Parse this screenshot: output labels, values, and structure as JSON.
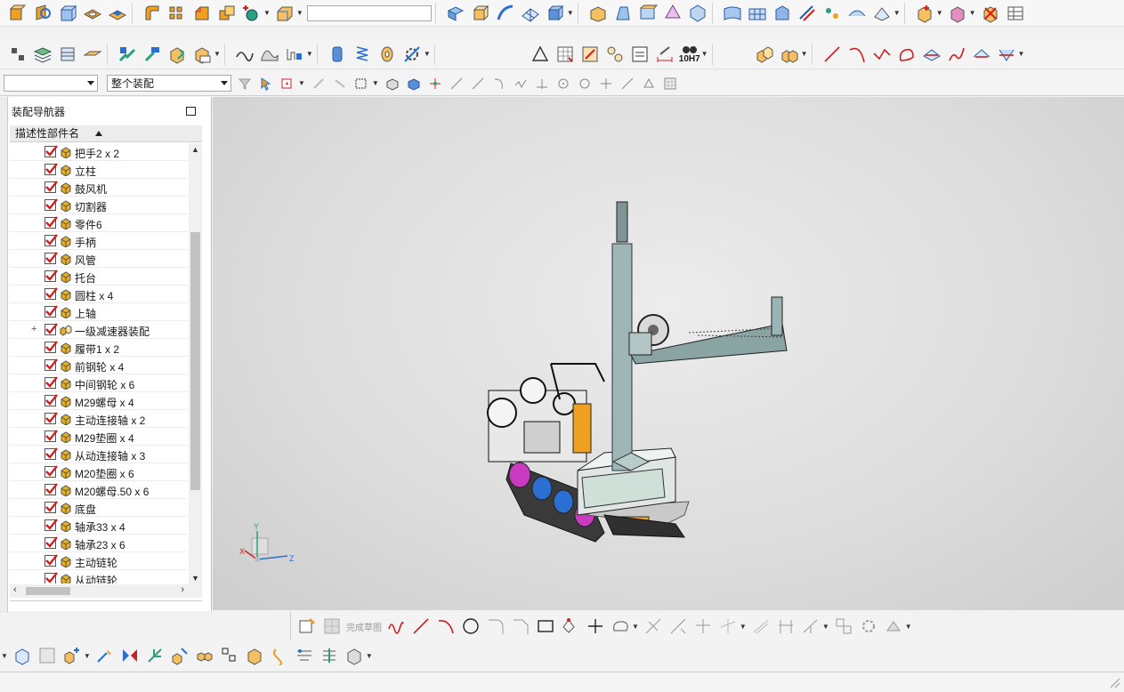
{
  "assembly_scope": {
    "filter_value": "",
    "scope_value": "整个装配"
  },
  "navigator": {
    "title": "装配导航器",
    "column_header": "描述性部件名",
    "items": [
      {
        "label": "把手2 x 2",
        "expandable": false
      },
      {
        "label": "立柱",
        "expandable": false
      },
      {
        "label": "鼓风机",
        "expandable": false
      },
      {
        "label": "切割器",
        "expandable": false
      },
      {
        "label": "零件6",
        "expandable": false
      },
      {
        "label": "手柄",
        "expandable": false
      },
      {
        "label": "风管",
        "expandable": false
      },
      {
        "label": "托台",
        "expandable": false
      },
      {
        "label": "圆柱 x 4",
        "expandable": false
      },
      {
        "label": "上轴",
        "expandable": false
      },
      {
        "label": "一级减速器装配",
        "expandable": true
      },
      {
        "label": "履带1 x 2",
        "expandable": false
      },
      {
        "label": "前钢轮 x 4",
        "expandable": false
      },
      {
        "label": "中间钢轮 x 6",
        "expandable": false
      },
      {
        "label": "M29螺母 x 4",
        "expandable": false
      },
      {
        "label": "主动连接轴 x 2",
        "expandable": false
      },
      {
        "label": "M29垫圈 x 4",
        "expandable": false
      },
      {
        "label": "从动连接轴 x 3",
        "expandable": false
      },
      {
        "label": "M20垫圈 x 6",
        "expandable": false
      },
      {
        "label": "M20螺母.50 x 6",
        "expandable": false
      },
      {
        "label": "底盘",
        "expandable": false
      },
      {
        "label": "轴承33 x 4",
        "expandable": false
      },
      {
        "label": "轴承23 x 6",
        "expandable": false
      },
      {
        "label": "主动链轮",
        "expandable": false
      },
      {
        "label": "从动链轮",
        "expandable": false
      }
    ]
  },
  "sketch_toolbar": {
    "finish_sketch_label": "完成草图"
  },
  "toolbar": {
    "tolerance_label": "10H7"
  },
  "triad": {
    "x_label": "X",
    "y_label": "Y",
    "z_label": "Z"
  },
  "colors": {
    "accent": "#1f6fd1",
    "check": "#d11f1f",
    "part_cube": "#e8b020"
  }
}
